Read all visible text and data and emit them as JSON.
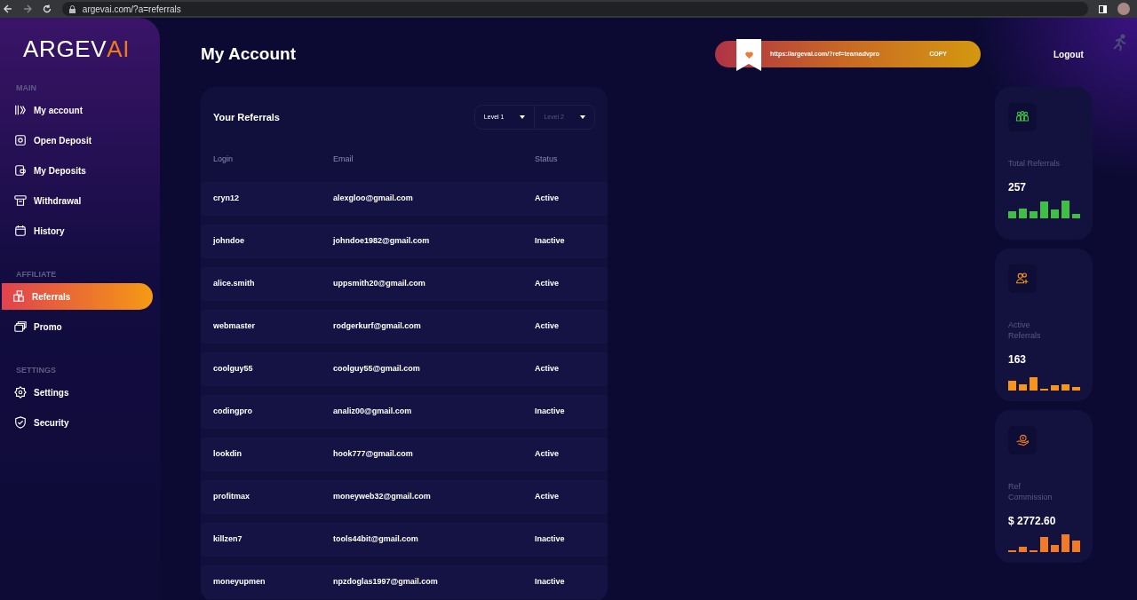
{
  "browser": {
    "url": "argevai.com/?a=referrals"
  },
  "logo": {
    "main": "ARGEV",
    "accent": "AI"
  },
  "sidebar": [
    {
      "heading": "MAIN",
      "items": [
        {
          "label": "My account",
          "selected": false
        },
        {
          "label": "Open Deposit",
          "selected": false
        },
        {
          "label": "My Deposits",
          "selected": false
        },
        {
          "label": "Withdrawal",
          "selected": false
        },
        {
          "label": "History",
          "selected": false
        }
      ]
    },
    {
      "heading": "AFFILIATE",
      "items": [
        {
          "label": "Referrals",
          "selected": true
        },
        {
          "label": "Promo",
          "selected": false
        }
      ]
    },
    {
      "heading": "SETTINGS",
      "items": [
        {
          "label": "Settings",
          "selected": false
        },
        {
          "label": "Security",
          "selected": false
        }
      ]
    }
  ],
  "page_title": "My Account",
  "ref_link": {
    "url": "https://argevai.com/?ref=teamadvpro",
    "button": "COPY"
  },
  "logout": "Logout",
  "referrals": {
    "title": "Your Referrals",
    "levels": [
      {
        "label": "Level 1",
        "selected": true
      },
      {
        "label": "Level 2",
        "selected": false
      }
    ],
    "columns": [
      "Login",
      "Email",
      "Status"
    ],
    "rows": [
      {
        "login": "cryn12",
        "email": "alexgloo@gmail.com",
        "status": "Active"
      },
      {
        "login": "johndoe",
        "email": "johndoe1982@gmail.com",
        "status": "Inactive"
      },
      {
        "login": "alice.smith",
        "email": "uppsmith20@gmail.com",
        "status": "Active"
      },
      {
        "login": "webmaster",
        "email": "rodgerkurf@gmail.com",
        "status": "Active"
      },
      {
        "login": "coolguy55",
        "email": "coolguy55@gmail.com",
        "status": "Active"
      },
      {
        "login": "codingpro",
        "email": "analiz00@gmail.com",
        "status": "Inactive"
      },
      {
        "login": "lookdin",
        "email": "hook777@gmail.com",
        "status": "Active"
      },
      {
        "login": "profitmax",
        "email": "moneyweb32@gmail.com",
        "status": "Active"
      },
      {
        "login": "killzen7",
        "email": "tools44bit@gmail.com",
        "status": "Inactive"
      },
      {
        "login": "moneyupmen",
        "email": "npzdoglas1997@gmail.com",
        "status": "Inactive"
      }
    ]
  },
  "stats": [
    {
      "kind": "total",
      "label": "Total Referrals",
      "value": "257",
      "color": "#3fbf45"
    },
    {
      "kind": "active",
      "label": "Active Referrals",
      "value": "163",
      "color": "#f7941d"
    },
    {
      "kind": "commission",
      "label": "Ref Commission",
      "value": "$ 2772.60",
      "color": "#ee7a2a"
    }
  ]
}
